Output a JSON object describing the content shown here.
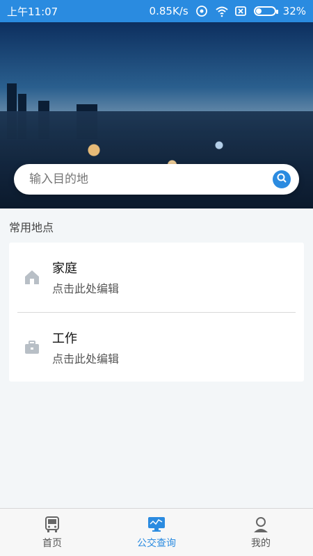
{
  "status_bar": {
    "time": "上午11:07",
    "network_speed": "0.85K/s",
    "battery_text": "32%",
    "battery_level": 0.32
  },
  "search": {
    "placeholder": "输入目的地"
  },
  "common_places": {
    "title": "常用地点",
    "items": [
      {
        "title": "家庭",
        "subtitle": "点击此处编辑",
        "icon": "home-icon"
      },
      {
        "title": "工作",
        "subtitle": "点击此处编辑",
        "icon": "briefcase-icon"
      }
    ]
  },
  "tabbar": {
    "items": [
      {
        "label": "首页",
        "icon": "bus-icon",
        "active": false
      },
      {
        "label": "公交查询",
        "icon": "bus-route-monitor-icon",
        "active": true
      },
      {
        "label": "我的",
        "icon": "user-icon",
        "active": false
      }
    ]
  },
  "colors": {
    "accent": "#2b8be0",
    "background": "#f3f6f8",
    "icon_gray": "#b8bfc6"
  }
}
